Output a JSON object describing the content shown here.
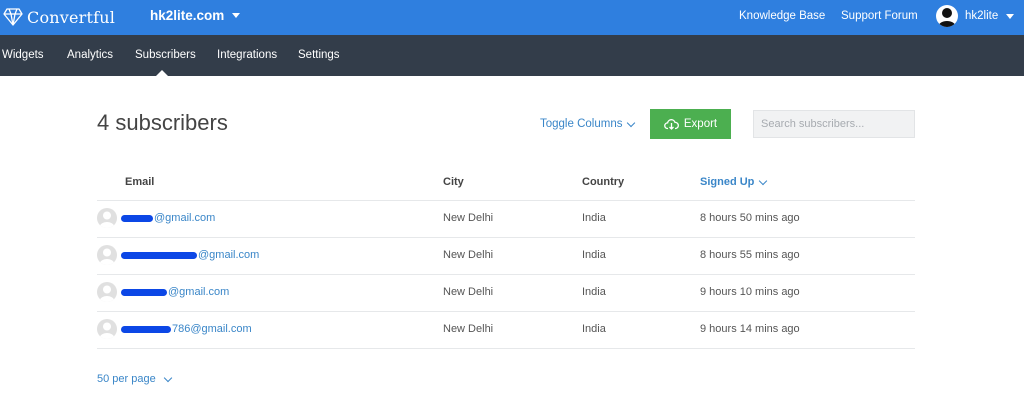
{
  "topbar": {
    "brand_name": "Convertful",
    "site": "hk2lite.com",
    "links": [
      "Knowledge Base",
      "Support Forum"
    ],
    "user_name": "hk2lite"
  },
  "nav": {
    "items": [
      "Widgets",
      "Analytics",
      "Subscribers",
      "Integrations",
      "Settings"
    ],
    "active": "Subscribers"
  },
  "main": {
    "title": "4 subscribers",
    "toggle_columns": "Toggle Columns",
    "export_label": "Export",
    "search_placeholder": "Search subscribers..."
  },
  "table": {
    "columns": [
      "Email",
      "City",
      "Country",
      "Signed Up"
    ],
    "sorted_column": "Signed Up",
    "rows": [
      {
        "email": "@gmail.com",
        "city": "New Delhi",
        "country": "India",
        "signed_up": "8 hours 50 mins ago"
      },
      {
        "email": "@gmail.com",
        "city": "New Delhi",
        "country": "India",
        "signed_up": "8 hours 55 mins ago"
      },
      {
        "email": "@gmail.com",
        "city": "New Delhi",
        "country": "India",
        "signed_up": "9 hours 10 mins ago"
      },
      {
        "email": "786@gmail.com",
        "city": "New Delhi",
        "country": "India",
        "signed_up": "9 hours 14 mins ago"
      }
    ]
  },
  "footer": {
    "per_page": "50 per page"
  },
  "colors": {
    "topbar": "#2f7fdf",
    "navbar": "#333d4a",
    "accent": "#3a86c8",
    "export": "#4caf50",
    "redaction": "#0c47e6"
  }
}
